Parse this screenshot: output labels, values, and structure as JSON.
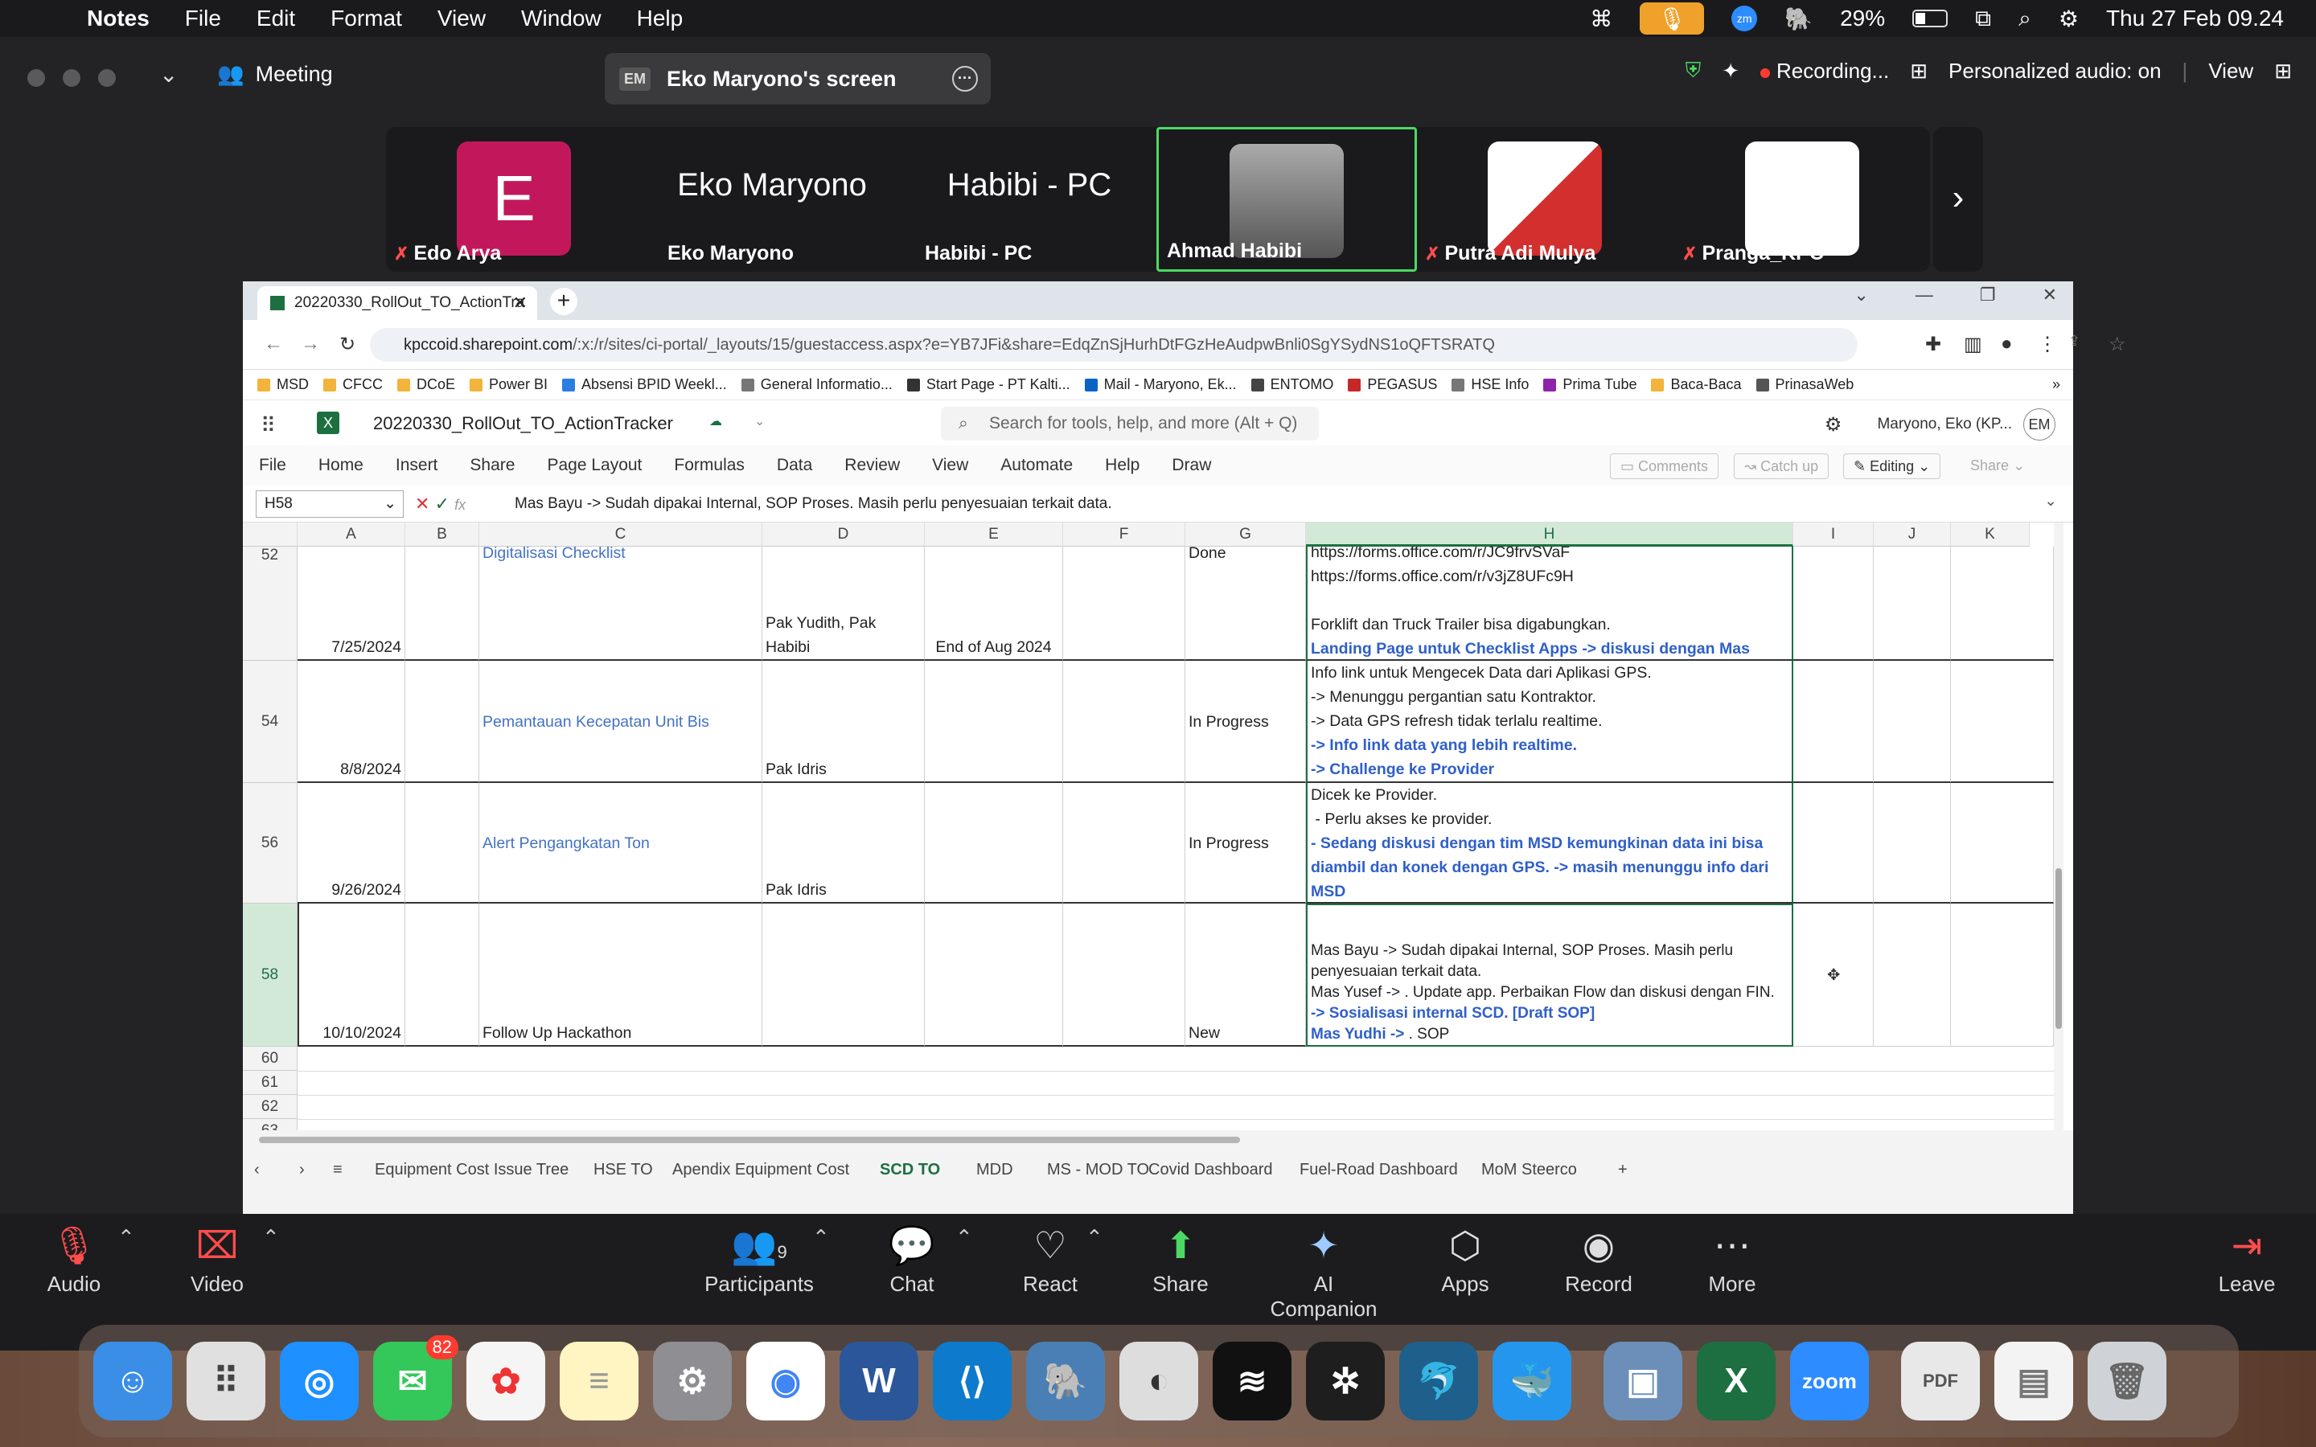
{
  "menubar": {
    "app": "Notes",
    "items": [
      "File",
      "Edit",
      "Format",
      "View",
      "Window",
      "Help"
    ],
    "battery": "29%",
    "datetime": "Thu 27 Feb  09.24"
  },
  "zoom": {
    "meeting_label": "Meeting",
    "screen_badge": "EM",
    "screen_title": "Eko Maryono's screen",
    "recording": "Recording...",
    "audio_mode": "Personalized audio: on",
    "view_label": "View",
    "participants": [
      {
        "name": "Edo Arya",
        "initial": "E"
      },
      {
        "name": "Eko Maryono",
        "big": "Eko Maryono"
      },
      {
        "name": "Habibi - PC",
        "big": "Habibi - PC"
      },
      {
        "name": "Ahmad Habibi"
      },
      {
        "name": "Putra Adi Mulya"
      },
      {
        "name": "Pranga_KPC"
      }
    ],
    "controls": {
      "audio": "Audio",
      "video": "Video",
      "participants": "Participants",
      "participants_count": "9",
      "chat": "Chat",
      "react": "React",
      "share": "Share",
      "ai": "AI Companion",
      "apps": "Apps",
      "record": "Record",
      "more": "More",
      "leave": "Leave"
    }
  },
  "browser": {
    "tab_title": "20220330_RollOut_TO_ActionTra",
    "url_host": "kpccoid.sharepoint.com",
    "url_path": "/:x:/r/sites/ci-portal/_layouts/15/guestaccess.aspx?e=YB7JFi&share=EdqZnSjHurhDtFGzHeAudpwBnli0SgYSydNS1oQFTSRATQ",
    "bookmarks": [
      "MSD",
      "CFCC",
      "DCoE",
      "Power BI",
      "Absensi BPID Weekl...",
      "General Informatio...",
      "Start Page - PT Kalti...",
      "Mail - Maryono, Ek...",
      "ENTOMO",
      "PEGASUS",
      "HSE Info",
      "Prima Tube",
      "Baca-Baca",
      "PrinasaWeb"
    ]
  },
  "excel": {
    "file_name": "20220330_RollOut_TO_ActionTracker",
    "search_placeholder": "Search for tools, help, and more (Alt + Q)",
    "user": "Maryono, Eko (KP...",
    "user_initials": "EM",
    "ribbon": [
      "File",
      "Home",
      "Insert",
      "Share",
      "Page Layout",
      "Formulas",
      "Data",
      "Review",
      "View",
      "Automate",
      "Help",
      "Draw"
    ],
    "comments": "Comments",
    "catchup": "Catch up",
    "editing": "Editing",
    "share": "Share",
    "namebox": "H58",
    "formula": "Mas Bayu -> Sudah dipakai Internal, SOP Proses. Masih perlu penyesuaian terkait data.",
    "columns": [
      "A",
      "B",
      "C",
      "D",
      "E",
      "F",
      "G",
      "H",
      "I",
      "J",
      "K"
    ],
    "rows": [
      {
        "num": "52",
        "date": "7/25/2024",
        "title": "Digitalisasi Checklist",
        "pic": "Pak Yudith, Pak Habibi",
        "target": "End of Aug 2024",
        "status": "Done",
        "notes": [
          "https://forms.office.com/r/JC9frvSVaF",
          "https://forms.office.com/r/v3jZ8UFc9H",
          "",
          "Forklift dan Truck Trailer bisa digabungkan."
        ],
        "notes_blue": [
          "Landing Page untuk Checklist Apps -> diskusi dengan Mas Bayu"
        ]
      },
      {
        "num": "54",
        "date": "8/8/2024",
        "title": "Pemantauan Kecepatan Unit Bis",
        "pic": "Pak Idris",
        "target": "",
        "status": "In Progress",
        "notes": [
          "Info link untuk Mengecek Data dari Aplikasi GPS.",
          "-> Menunggu pergantian satu Kontraktor.",
          "-> Data GPS refresh tidak terlalu realtime."
        ],
        "notes_blue": [
          "-> Info link data yang lebih realtime.",
          "-> Challenge ke Provider"
        ]
      },
      {
        "num": "56",
        "date": "9/26/2024",
        "title": "Alert Pengangkatan Ton",
        "pic": "Pak Idris",
        "target": "",
        "status": "In Progress",
        "notes": [
          "Dicek ke Provider.",
          " - Perlu akses ke provider."
        ],
        "notes_blue": [
          "- Sedang diskusi dengan tim MSD kemungkinan data ini bisa diambil dan konek dengan GPS. -> masih menunggu info dari MSD"
        ]
      },
      {
        "num": "58",
        "date": "10/10/2024",
        "title": "Follow Up Hackathon",
        "pic": "",
        "target": "",
        "status": "New",
        "notes": [
          "Mas Bayu -> Sudah dipakai Internal, SOP Proses. Masih perlu penyesuaian terkait data.",
          "Mas Yusef -> . Update app. Perbaikan Flow dan diskusi dengan FIN."
        ],
        "notes_blue": [
          "-> Sosialisasi internal SCD. [Draft SOP]",
          "Mas Yudhi -> "
        ],
        "notes_tail": ". SOP"
      }
    ],
    "empty_rows": [
      "60",
      "61",
      "62",
      "63"
    ],
    "sheets": [
      "Equipment Cost Issue Tree",
      "HSE TO",
      "Apendix Equipment Cost",
      "SCD TO",
      "MDD",
      "MS - MOD TO",
      "Covid Dashboard",
      "Fuel-Road Dashboard",
      "MoM Steerco"
    ]
  },
  "dock": {
    "messages_badge": "82",
    "word": "W",
    "excel": "X",
    "zoom": "zoom"
  }
}
